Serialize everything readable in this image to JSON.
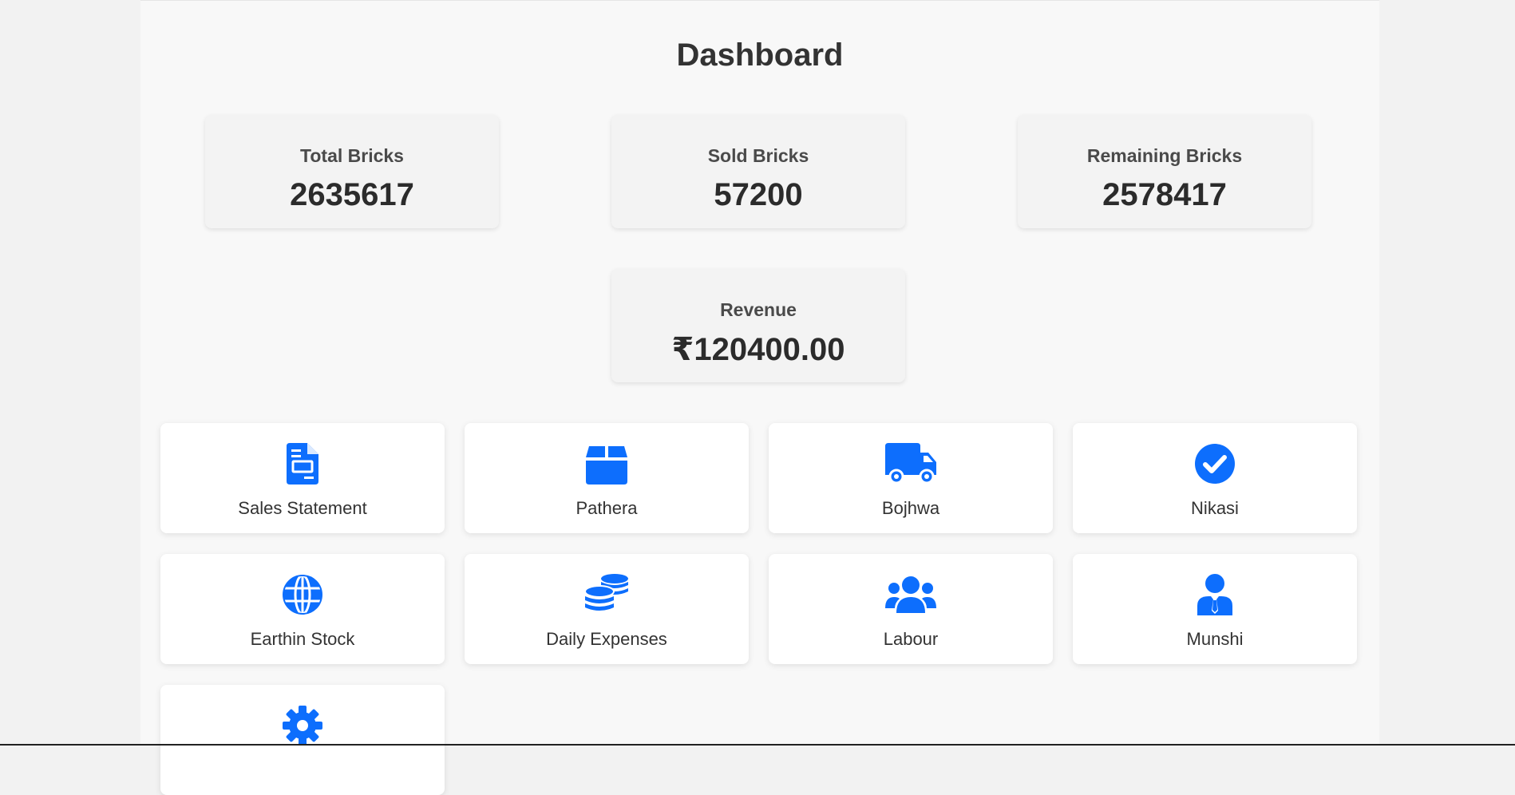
{
  "page": {
    "title": "Dashboard"
  },
  "stats": [
    {
      "label": "Total Bricks",
      "value": "2635617"
    },
    {
      "label": "Sold Bricks",
      "value": "57200"
    },
    {
      "label": "Remaining Bricks",
      "value": "2578417"
    },
    {
      "label": "Revenue",
      "value": "₹120400.00"
    }
  ],
  "tiles": [
    {
      "label": "Sales Statement",
      "icon": "file-invoice-icon"
    },
    {
      "label": "Pathera",
      "icon": "box-icon"
    },
    {
      "label": "Bojhwa",
      "icon": "truck-icon"
    },
    {
      "label": "Nikasi",
      "icon": "check-circle-icon"
    },
    {
      "label": "Earthin Stock",
      "icon": "globe-icon"
    },
    {
      "label": "Daily Expenses",
      "icon": "coins-icon"
    },
    {
      "label": "Labour",
      "icon": "users-icon"
    },
    {
      "label": "Munshi",
      "icon": "user-tie-icon"
    },
    {
      "label": "",
      "icon": "gear-icon"
    }
  ],
  "colors": {
    "accent": "#0d6efd",
    "card_bg": "#f3f3f3",
    "tile_bg": "#ffffff",
    "page_bg": "#f8f8f8"
  }
}
